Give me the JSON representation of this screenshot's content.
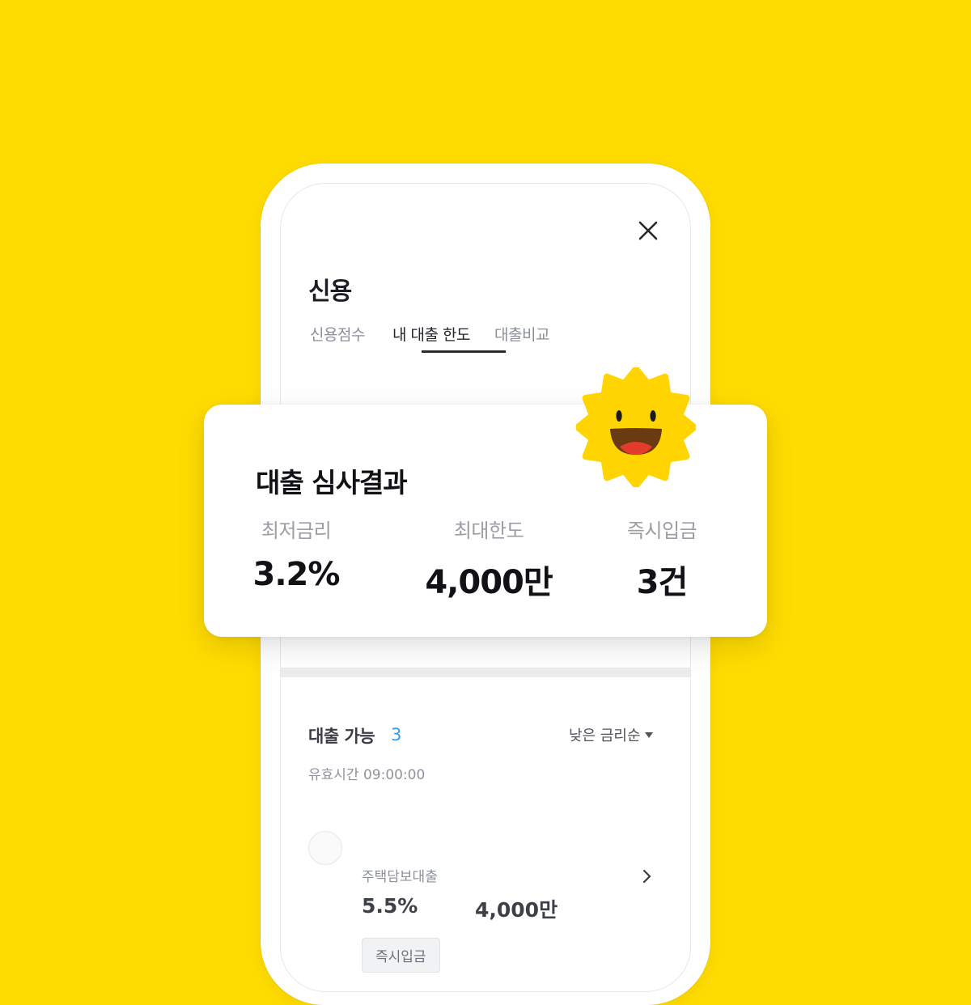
{
  "header": {
    "close_icon": "close-icon",
    "title": "신용"
  },
  "tabs": [
    {
      "label": "신용점수",
      "active": false
    },
    {
      "label": "내 대출 한도",
      "active": true
    },
    {
      "label": "대출비교",
      "active": false
    }
  ],
  "result_card": {
    "title": "대출 심사결과",
    "mascot_icon": "smiling-sun-icon",
    "stats": [
      {
        "label": "최저금리",
        "value": "3.2%"
      },
      {
        "label": "최대한도",
        "value": "4,000만"
      },
      {
        "label": "즉시입금",
        "value": "3건"
      }
    ]
  },
  "loan_list": {
    "label": "대출 가능",
    "count": "3",
    "sort_label": "낮은 금리순",
    "valid_time": "유효시간 09:00:00",
    "items": [
      {
        "name": "주택담보대출",
        "rate": "5.5%",
        "limit": "4,000만",
        "badge": "즉시입금"
      }
    ]
  },
  "colors": {
    "background": "#FFDC00",
    "accent_blue": "#2E9CF0",
    "text_primary": "#111216"
  }
}
